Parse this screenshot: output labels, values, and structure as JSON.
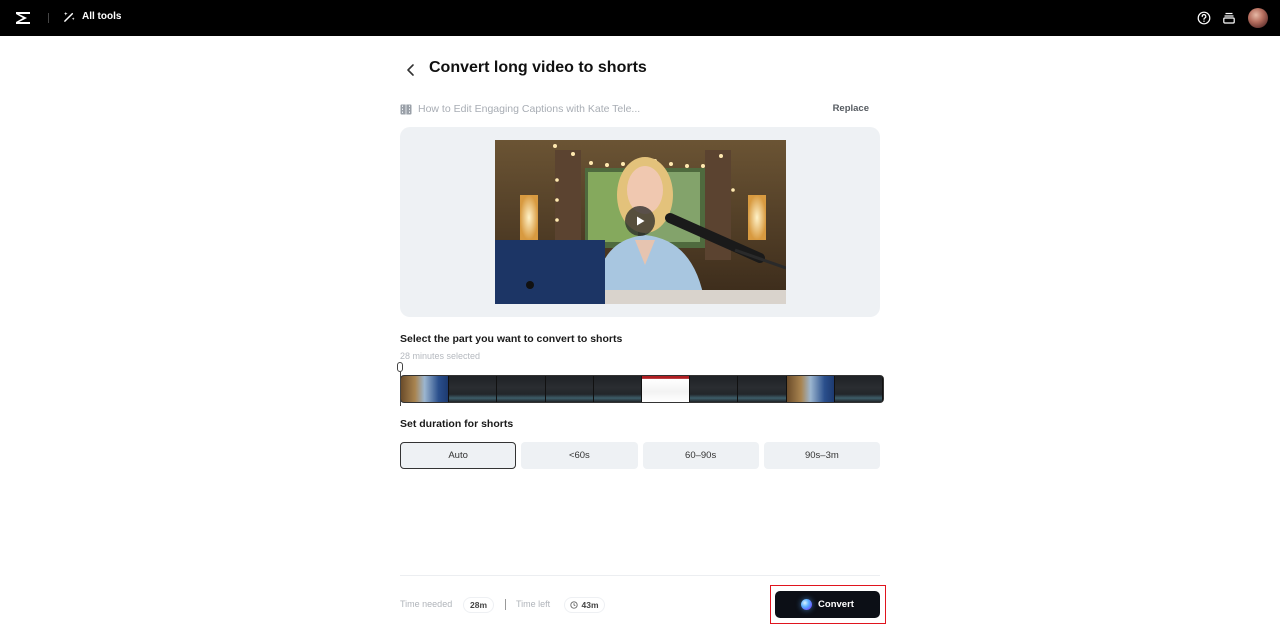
{
  "topbar": {
    "logo_icon": "capcut-logo-icon",
    "all_tools_label": "All tools",
    "all_tools_icon": "magic-wand-icon",
    "help_icon": "help-circle-icon",
    "inbox_icon": "inbox-stack-icon",
    "avatar_icon": "user-avatar"
  },
  "header": {
    "back_icon": "chevron-left-icon",
    "title": "Convert long video to shorts"
  },
  "file": {
    "icon": "film-icon",
    "name": "How to Edit Engaging Captions with Kate Tele...",
    "replace_label": "Replace"
  },
  "preview": {
    "play_icon": "play-icon"
  },
  "selection": {
    "label": "Select the part you want to convert to shorts",
    "subtext": "28 minutes selected",
    "frames": [
      "person",
      "editor",
      "editor",
      "editor",
      "editor",
      "webpage",
      "editor",
      "editor",
      "person",
      "editor"
    ]
  },
  "duration": {
    "label": "Set duration for shorts",
    "options": [
      "Auto",
      "<60s",
      "60–90s",
      "90s–3m"
    ],
    "selected": "Auto"
  },
  "footer": {
    "time_needed_label": "Time needed",
    "time_needed_value": "28m",
    "time_left_label": "Time left",
    "time_left_value": "43m",
    "time_left_icon": "clock-icon",
    "convert_label": "Convert",
    "convert_icon": "ai-orb-icon"
  }
}
